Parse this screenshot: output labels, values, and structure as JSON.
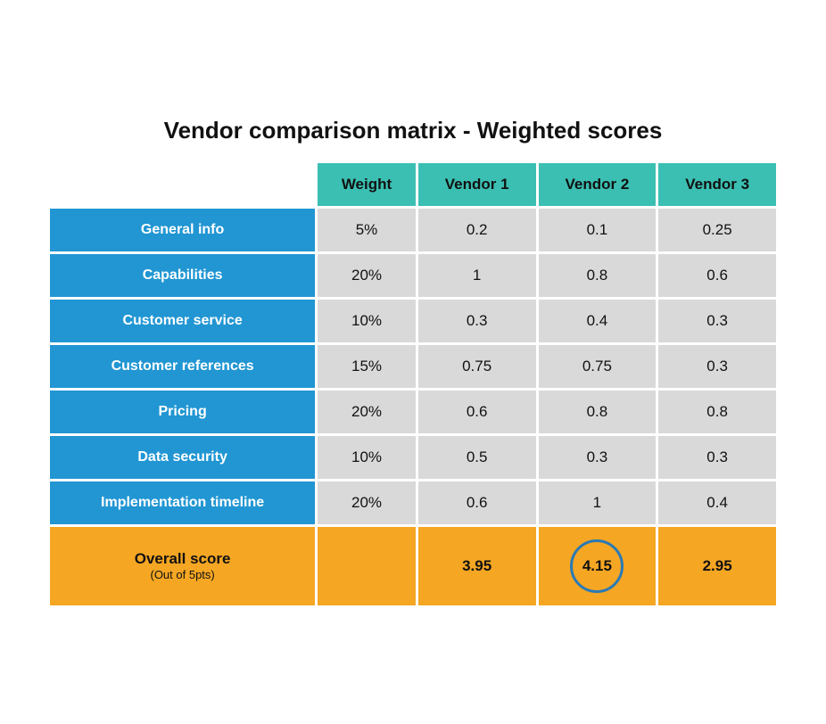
{
  "title": "Vendor comparison matrix - Weighted scores",
  "header": {
    "col1": "",
    "col2": "Weight",
    "col3": "Vendor 1",
    "col4": "Vendor 2",
    "col5": "Vendor 3"
  },
  "rows": [
    {
      "label": "General info",
      "weight": "5%",
      "v1": "0.2",
      "v2": "0.1",
      "v3": "0.25"
    },
    {
      "label": "Capabilities",
      "weight": "20%",
      "v1": "1",
      "v2": "0.8",
      "v3": "0.6"
    },
    {
      "label": "Customer service",
      "weight": "10%",
      "v1": "0.3",
      "v2": "0.4",
      "v3": "0.3"
    },
    {
      "label": "Customer references",
      "weight": "15%",
      "v1": "0.75",
      "v2": "0.75",
      "v3": "0.3"
    },
    {
      "label": "Pricing",
      "weight": "20%",
      "v1": "0.6",
      "v2": "0.8",
      "v3": "0.8"
    },
    {
      "label": "Data security",
      "weight": "10%",
      "v1": "0.5",
      "v2": "0.3",
      "v3": "0.3"
    },
    {
      "label": "Implementation timeline",
      "weight": "20%",
      "v1": "0.6",
      "v2": "1",
      "v3": "0.4"
    }
  ],
  "footer": {
    "label": "Overall score",
    "sublabel": "(Out of 5pts)",
    "v1": "3.95",
    "v2": "4.15",
    "v3": "2.95"
  }
}
